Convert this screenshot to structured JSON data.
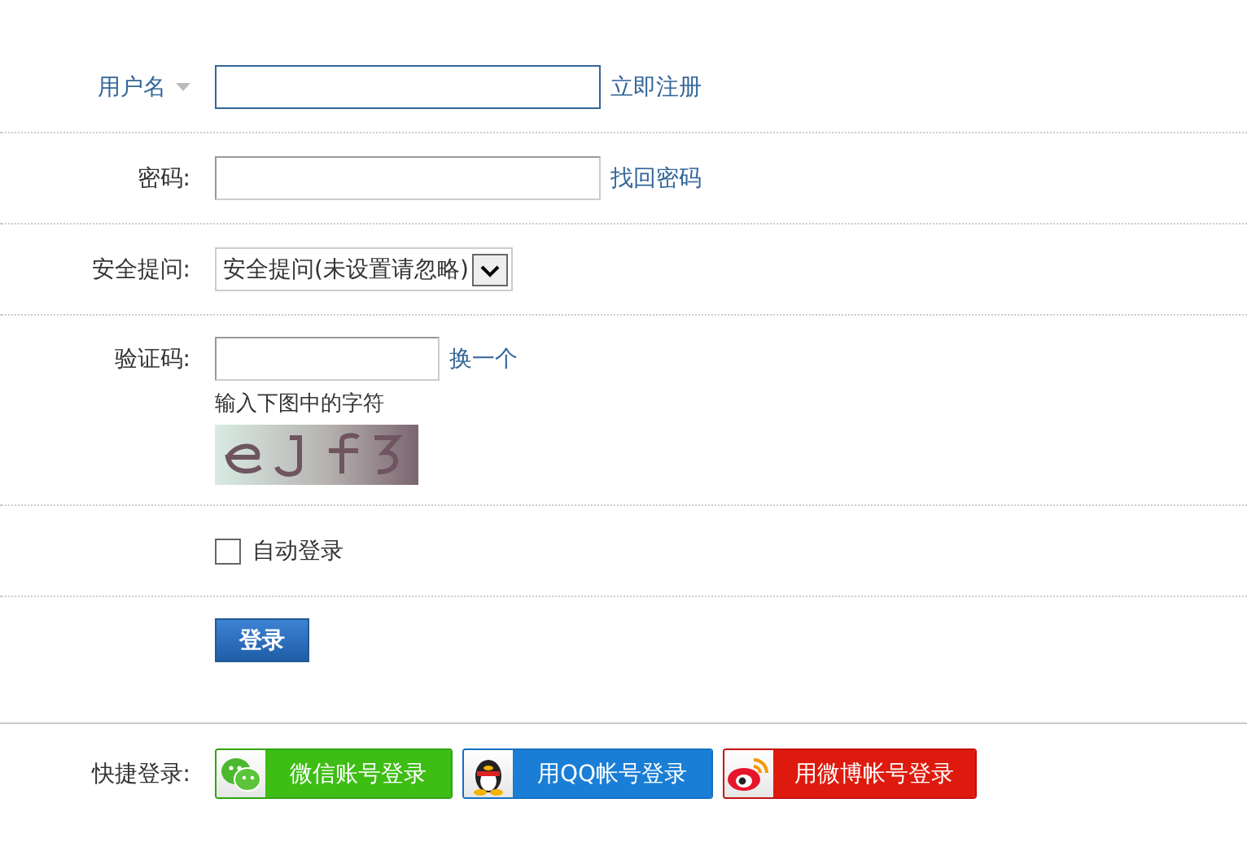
{
  "username": {
    "label": "用户名",
    "focused": true,
    "link": "立即注册"
  },
  "password": {
    "label": "密码:",
    "link": "找回密码"
  },
  "security_question": {
    "label": "安全提问:",
    "value": "安全提问(未设置请忽略)"
  },
  "captcha": {
    "label": "验证码:",
    "link": "换一个",
    "hint": "输入下图中的字符"
  },
  "remember": {
    "label": "自动登录",
    "checked": false
  },
  "submit": "登录",
  "quick_login": {
    "label": "快捷登录:",
    "buttons": [
      {
        "kind": "wechat",
        "label": "微信账号登录"
      },
      {
        "kind": "qq",
        "label": "用QQ帐号登录"
      },
      {
        "kind": "weibo",
        "label": "用微博帐号登录"
      }
    ]
  }
}
